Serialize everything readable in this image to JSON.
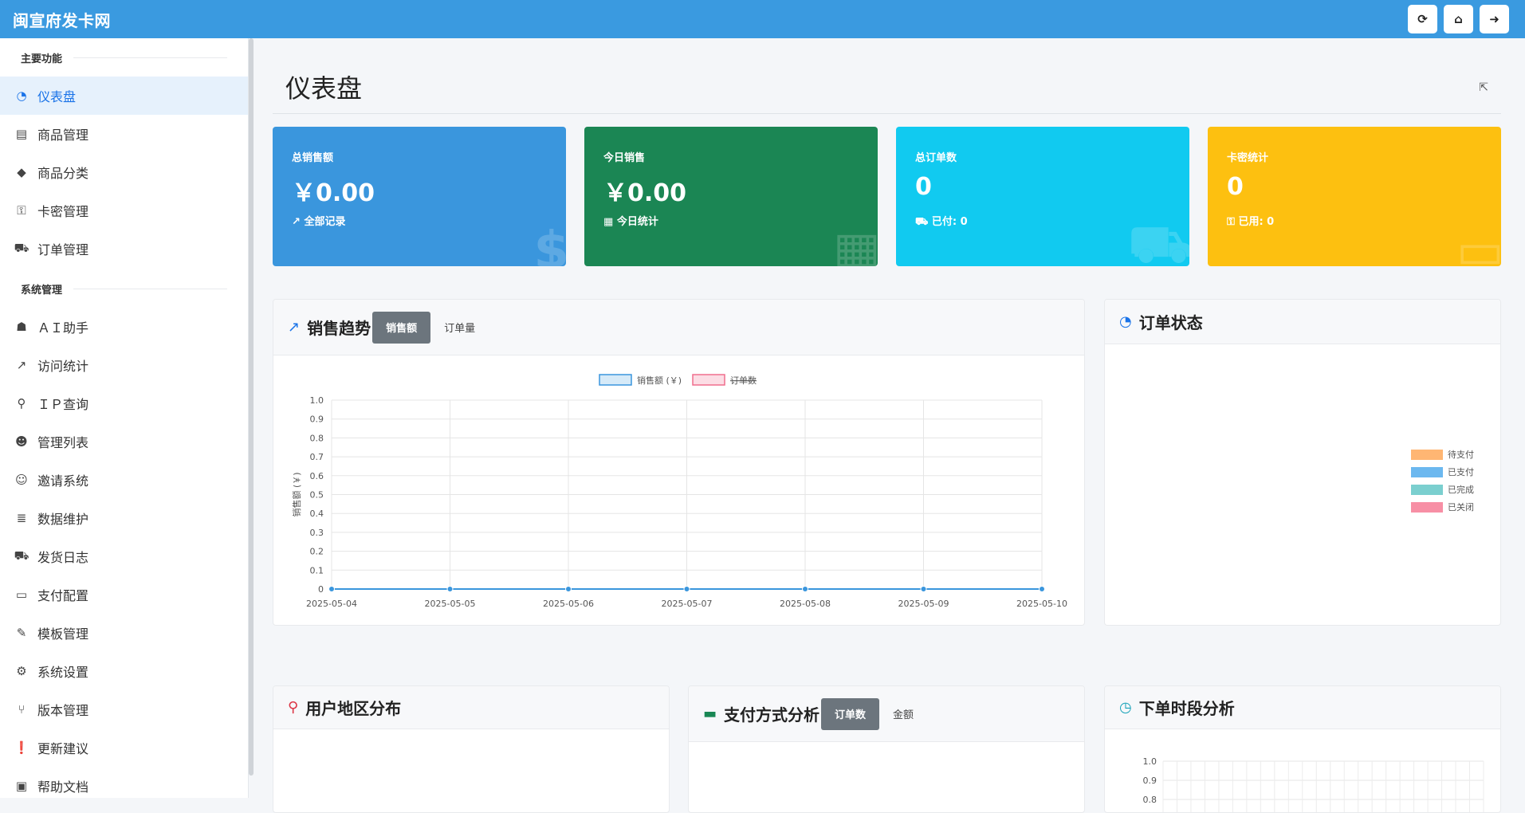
{
  "topbar": {
    "brand": "闽宣府发卡网",
    "buttons": [
      {
        "name": "refresh-icon",
        "glyph": "⟳"
      },
      {
        "name": "home-icon",
        "glyph": "⌂"
      },
      {
        "name": "logout-icon",
        "glyph": "➜"
      }
    ]
  },
  "sidebar": {
    "section_main": "主要功能",
    "section_system": "系统管理",
    "main_items": [
      {
        "label": "仪表盘",
        "icon": "◔"
      },
      {
        "label": "商品管理",
        "icon": "▤"
      },
      {
        "label": "商品分类",
        "icon": "◆"
      },
      {
        "label": "卡密管理",
        "icon": "⚿"
      },
      {
        "label": "订单管理",
        "icon": "⛟"
      }
    ],
    "system_items": [
      {
        "label": "ＡＩ助手",
        "icon": "☗"
      },
      {
        "label": "访问统计",
        "icon": "↗"
      },
      {
        "label": "ＩＰ查询",
        "icon": "⚲"
      },
      {
        "label": "管理列表",
        "icon": "☻"
      },
      {
        "label": "邀请系统",
        "icon": "☺"
      },
      {
        "label": "数据维护",
        "icon": "≣"
      },
      {
        "label": "发货日志",
        "icon": "⛟"
      },
      {
        "label": "支付配置",
        "icon": "▭"
      },
      {
        "label": "模板管理",
        "icon": "✎"
      },
      {
        "label": "系统设置",
        "icon": "⚙"
      },
      {
        "label": "版本管理",
        "icon": "⑂"
      },
      {
        "label": "更新建议",
        "icon": "❗"
      },
      {
        "label": "帮助文档",
        "icon": "▣"
      }
    ]
  },
  "page": {
    "title": "仪表盘",
    "external_icon": "⇱"
  },
  "stats": [
    {
      "label": "总销售额",
      "value": "￥0.00",
      "sub": "全部记录",
      "sub_icon": "↗",
      "bg_icon": "$",
      "color": "#3a96dd"
    },
    {
      "label": "今日销售",
      "value": "￥0.00",
      "sub": "今日统计",
      "sub_icon": "▦",
      "bg_icon": "▦",
      "color": "#1b8654"
    },
    {
      "label": "总订单数",
      "value": "0",
      "sub": "已付: 0",
      "sub_icon": "⛟",
      "bg_icon": "⛟",
      "color": "#11caf0"
    },
    {
      "label": "卡密统计",
      "value": "0",
      "sub": "已用: 0",
      "sub_icon": "⚿",
      "bg_icon": "▭",
      "color": "#fdc010"
    }
  ],
  "sales_trend": {
    "title": "销售趋势",
    "tabs": [
      "销售额",
      "订单量"
    ],
    "active_tab": 0
  },
  "order_status": {
    "title": "订单状态",
    "legend": [
      {
        "label": "待支付",
        "color": "#ffb673"
      },
      {
        "label": "已支付",
        "color": "#6cb8ef"
      },
      {
        "label": "已完成",
        "color": "#7bcfcf"
      },
      {
        "label": "已关闭",
        "color": "#f78fa5"
      }
    ]
  },
  "region": {
    "title": "用户地区分布"
  },
  "payment": {
    "title": "支付方式分析",
    "tabs": [
      "订单数",
      "金额"
    ],
    "active_tab": 0
  },
  "time_period": {
    "title": "下单时段分析",
    "yticks": [
      "1.0",
      "0.9",
      "0.8"
    ]
  },
  "chart_data": {
    "type": "line",
    "x": [
      "2025-05-04",
      "2025-05-05",
      "2025-05-06",
      "2025-05-07",
      "2025-05-08",
      "2025-05-09",
      "2025-05-10"
    ],
    "series": [
      {
        "name": "销售额 (￥)",
        "values": [
          0,
          0,
          0,
          0,
          0,
          0,
          0
        ],
        "color": "#3a96dd",
        "fill": "#d6eaf8"
      },
      {
        "name": "订单数",
        "values": [],
        "color": "#f06f8d",
        "fill": "#fcdde5",
        "hidden": true
      }
    ],
    "ylabel": "销售额 (￥)",
    "ylim": [
      0,
      1.0
    ],
    "yticks": [
      "0",
      "0.1",
      "0.2",
      "0.3",
      "0.4",
      "0.5",
      "0.6",
      "0.7",
      "0.8",
      "0.9",
      "1.0"
    ],
    "legend": "top-center",
    "grid": true
  }
}
